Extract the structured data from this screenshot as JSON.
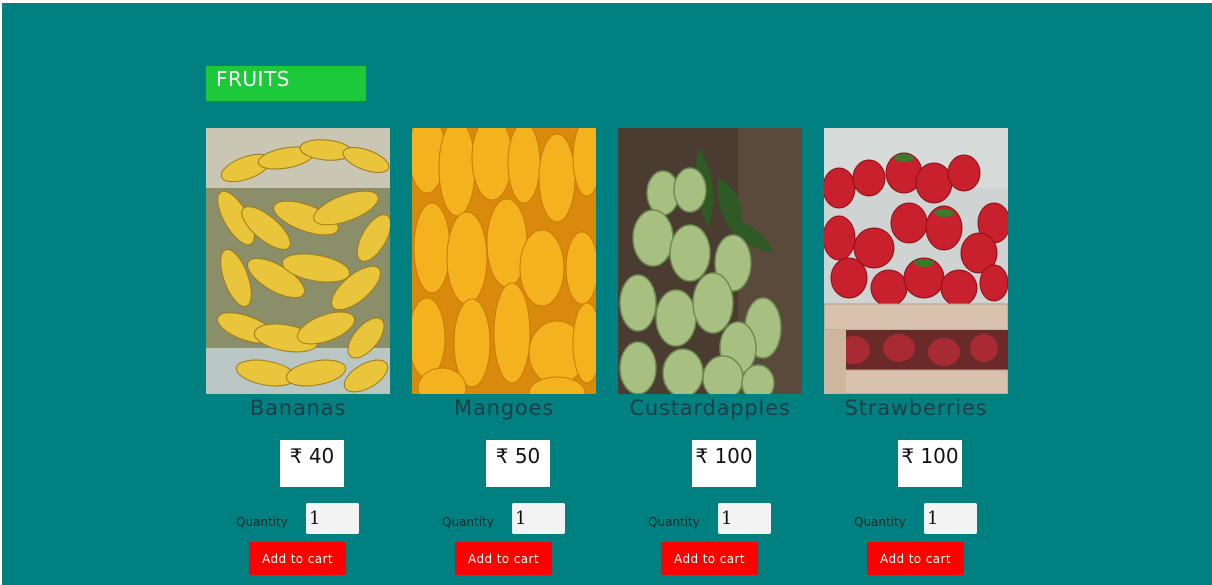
{
  "section": {
    "title": "FRUITS"
  },
  "products": [
    {
      "name": "Bananas",
      "price": "₹ 40",
      "quantity_label": "Quantity",
      "quantity": "1",
      "button_label": "Add to cart",
      "image_icon": "banana-image"
    },
    {
      "name": "Mangoes",
      "price": "₹ 50",
      "quantity_label": "Quantity",
      "quantity": "1",
      "button_label": "Add to cart",
      "image_icon": "mango-image"
    },
    {
      "name": "Custardapples",
      "price": "₹ 100",
      "quantity_label": "Quantity",
      "quantity": "1",
      "button_label": "Add to cart",
      "image_icon": "custard-apple-image"
    },
    {
      "name": "Strawberries",
      "price": "₹ 100",
      "quantity_label": "Quantity",
      "quantity": "1",
      "button_label": "Add to cart",
      "image_icon": "strawberry-image"
    }
  ],
  "colors": {
    "background": "#008080",
    "title_bg": "#1bc93a",
    "button_bg": "#ff0000",
    "name_text": "#1f3f48"
  }
}
